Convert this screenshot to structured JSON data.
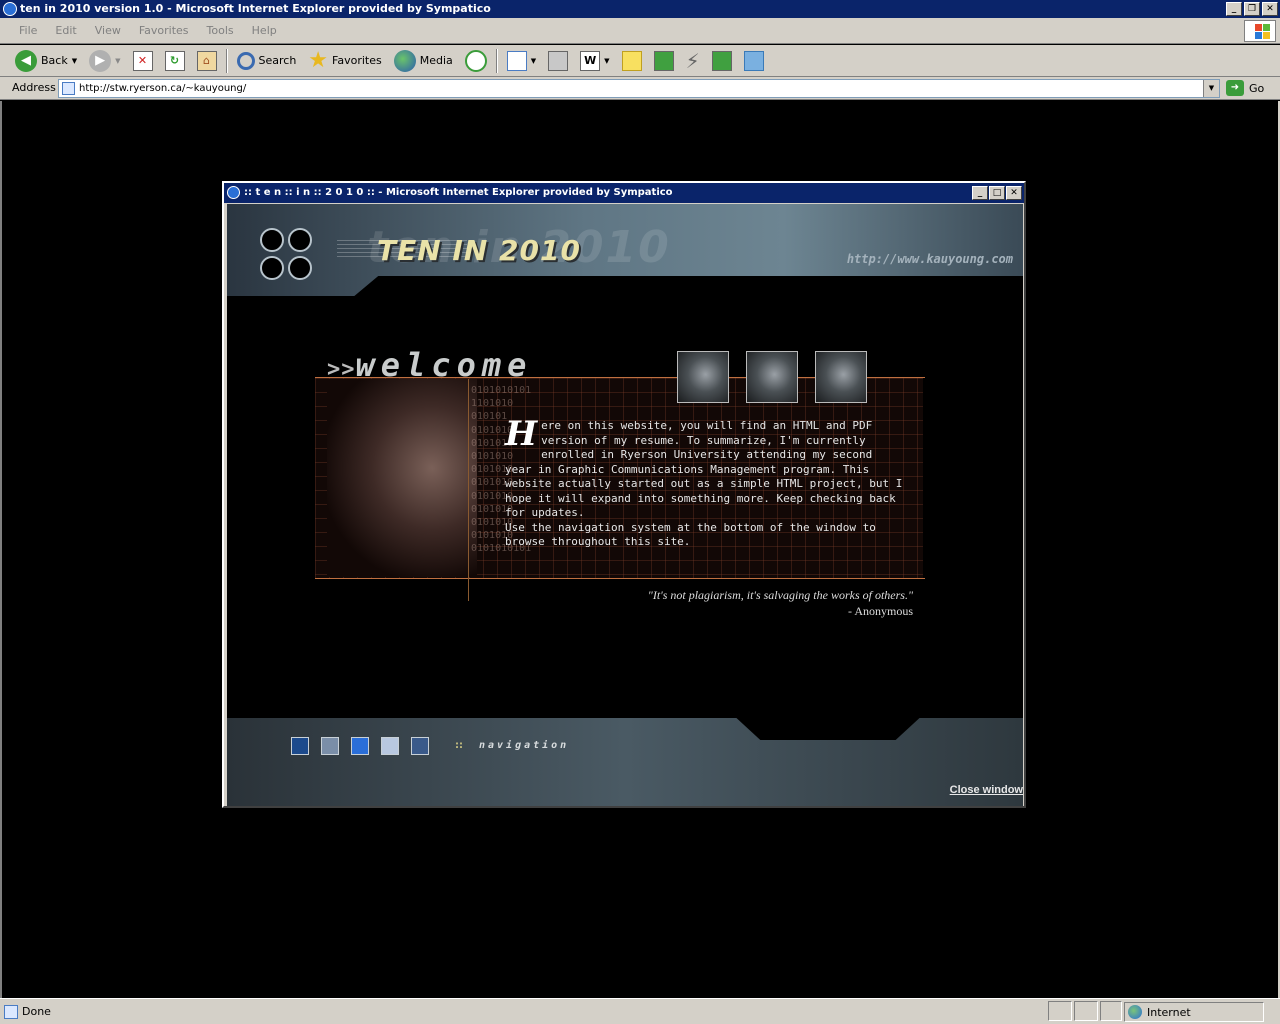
{
  "browser": {
    "window_title": "ten in 2010 version 1.0 - Microsoft Internet Explorer provided by Sympatico",
    "menu": [
      "File",
      "Edit",
      "View",
      "Favorites",
      "Tools",
      "Help"
    ],
    "toolbar": {
      "back": "Back",
      "search": "Search",
      "favorites": "Favorites",
      "media": "Media"
    },
    "address_label": "Address",
    "address_value": "http://stw.ryerson.ca/~kauyoung/",
    "go_label": "Go",
    "status_text": "Done",
    "zone_text": "Internet"
  },
  "popup": {
    "title": ":: t e n :: i n :: 2 0 1 0 :: - Microsoft Internet Explorer provided by Sympatico",
    "site_title": "TEN IN 2010",
    "ghost_title": "ten in 2010",
    "site_url": "http://www.kauyoung.com",
    "welcome_arrows": ">>",
    "welcome_word": "welcome",
    "binary": "0101010101\n1101010\n010101\n0101010\n0101010\n0101010\n0101010\n0101010\n0101010\n0101010\n0101010\n0101010\n0101010101",
    "dropcap": "H",
    "body_text": "ere on this website, you will find an HTML and PDF version of my resume. To summarize, I'm currently enrolled in Ryerson University attending my second year in Graphic Communications Management program. This website actually started out as a simple HTML project, but I hope it will expand into something more. Keep checking back for updates.",
    "body_text_2": "Use the navigation system at the bottom of the window to browse throughout this site.",
    "quote": "\"It's not plagiarism, it's salvaging the works of others.\"",
    "quote_author": "- Anonymous",
    "nav_dots": "::",
    "nav_label": "navigation",
    "close_label": "Close window",
    "nav_colors": [
      "#1c4a8c",
      "#7a8ea8",
      "#2a6ed8",
      "#b8c8e0",
      "#3a5a8a"
    ]
  }
}
